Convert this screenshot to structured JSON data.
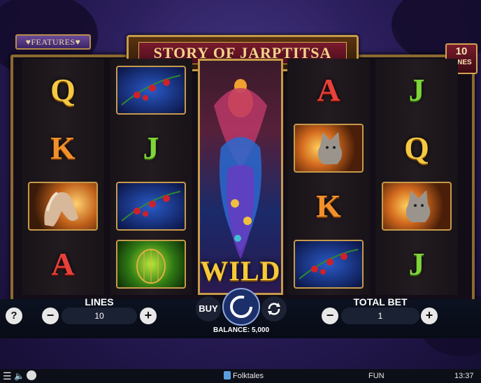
{
  "game": {
    "title": "STORY OF JARPTITSA",
    "features_label": "♥FEATURES♥",
    "lines_badge": {
      "number": "10",
      "text": "LINES"
    }
  },
  "reels": [
    [
      {
        "type": "letter",
        "label": "Q"
      },
      {
        "type": "letter",
        "label": "K"
      },
      {
        "type": "horse-card"
      },
      {
        "type": "letter",
        "label": "A"
      }
    ],
    [
      {
        "type": "rose-card"
      },
      {
        "type": "letter",
        "label": "J"
      },
      {
        "type": "rose-card"
      },
      {
        "type": "cage-card"
      }
    ],
    [
      {
        "type": "wild",
        "label": "WILD"
      }
    ],
    [
      {
        "type": "letter",
        "label": "A"
      },
      {
        "type": "wolf-card"
      },
      {
        "type": "letter",
        "label": "K"
      },
      {
        "type": "rose-card"
      }
    ],
    [
      {
        "type": "letter",
        "label": "J"
      },
      {
        "type": "letter",
        "label": "Q"
      },
      {
        "type": "wolf-card"
      },
      {
        "type": "letter",
        "label": "J"
      }
    ]
  ],
  "controls": {
    "help": "?",
    "lines_label": "LINES",
    "lines_value": "10",
    "buy_label": "BUY",
    "balance_text": "BALANCE: 5,000",
    "total_bet_label": "TOTAL BET",
    "total_bet_value": "1",
    "minus": "−",
    "plus": "+"
  },
  "statusbar": {
    "brand": "Folktales",
    "mode": "FUN",
    "clock": "13:37"
  },
  "colors": {
    "gold": "#c79a4a",
    "accent_red": "#7b1b2e",
    "bg": "#2a1d5a"
  }
}
